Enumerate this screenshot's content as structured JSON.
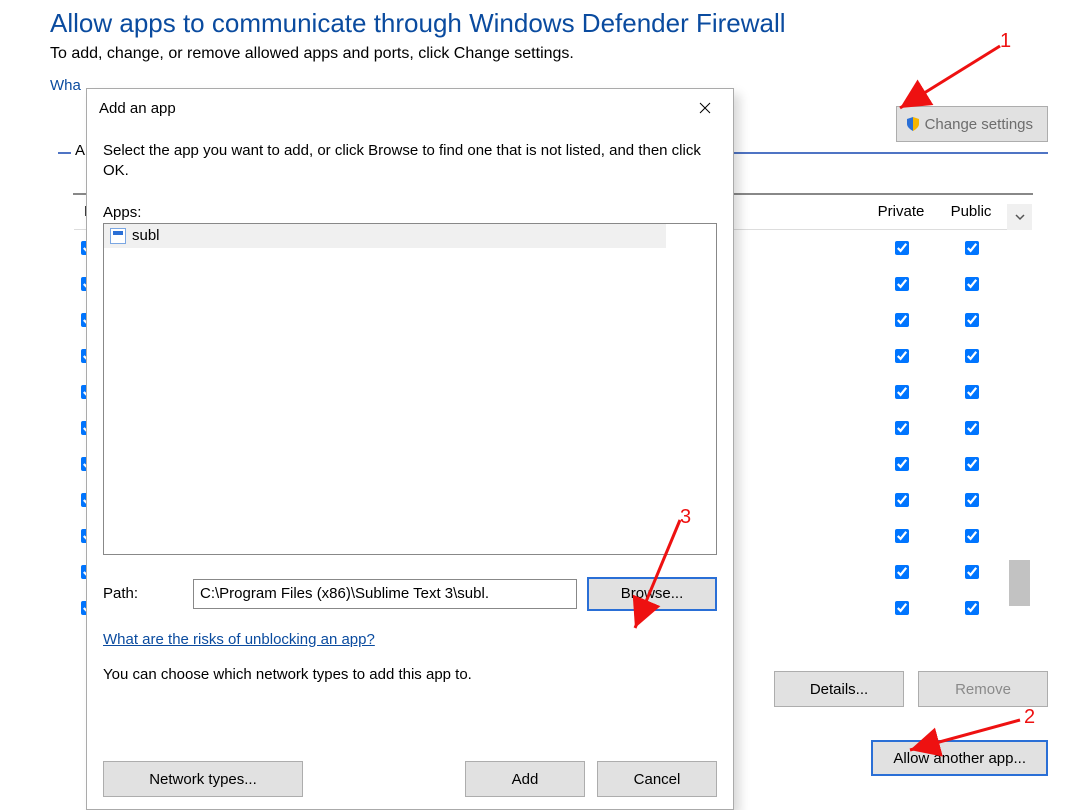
{
  "page": {
    "title": "Allow apps to communicate through Windows Defender Firewall",
    "subtitle": "To add, change, or remove allowed apps and ports, click Change settings.",
    "what_link_fragment": "Wha",
    "change_settings": "Change settings",
    "groupbox_label": "A",
    "header_name_col": "N",
    "header_private": "Private",
    "header_public": "Public",
    "details_btn": "Details...",
    "remove_btn": "Remove",
    "allow_another_btn": "Allow another app...",
    "rows": [
      {
        "lead": true,
        "private": true,
        "public": true
      },
      {
        "lead": true,
        "private": true,
        "public": true
      },
      {
        "lead": true,
        "private": true,
        "public": true
      },
      {
        "lead": true,
        "private": true,
        "public": true
      },
      {
        "lead": true,
        "private": true,
        "public": true
      },
      {
        "lead": true,
        "private": true,
        "public": true
      },
      {
        "lead": true,
        "private": true,
        "public": true
      },
      {
        "lead": true,
        "private": true,
        "public": true
      },
      {
        "lead": true,
        "private": true,
        "public": true
      },
      {
        "lead": true,
        "private": true,
        "public": true
      },
      {
        "lead": true,
        "private": true,
        "public": true
      }
    ]
  },
  "dialog": {
    "title": "Add an app",
    "instruction": "Select the app you want to add, or click Browse to find one that is not listed, and then click OK.",
    "apps_label": "Apps:",
    "app_items": [
      {
        "name": "subl"
      }
    ],
    "path_label": "Path:",
    "path_value": "C:\\Program Files (x86)\\Sublime Text 3\\subl.",
    "browse_btn": "Browse...",
    "risk_link": "What are the risks of unblocking an app?",
    "choose_text": "You can choose which network types to add this app to.",
    "network_types_btn": "Network types...",
    "add_btn": "Add",
    "cancel_btn": "Cancel"
  },
  "annotations": {
    "n1": "1",
    "n2": "2",
    "n3": "3"
  }
}
